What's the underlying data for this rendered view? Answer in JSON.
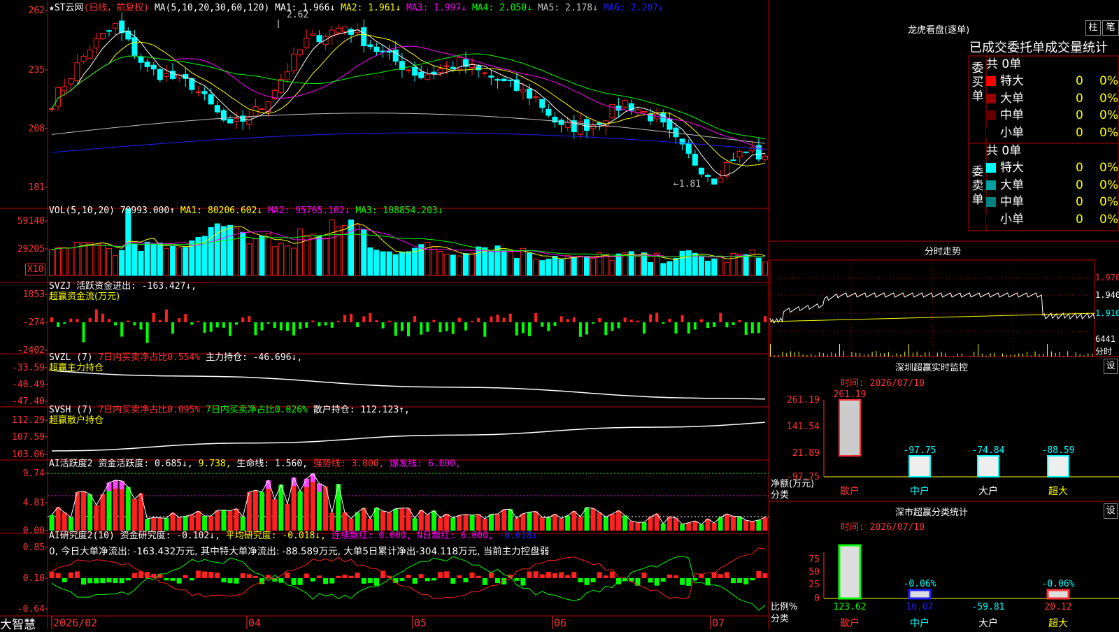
{
  "stock": {
    "name": "★ST云网",
    "period": "(日线，前复权)"
  },
  "main_ma": {
    "prefix": "MA(5,10,20,30,60,120)",
    "items": [
      {
        "text": "MA1: 1.966↓",
        "color": "#ffffff"
      },
      {
        "text": "MA2: 1.961↓",
        "color": "#ffff00"
      },
      {
        "text": "MA3: 1.997↓",
        "color": "#ff00ff"
      },
      {
        "text": "MA4: 2.050↓",
        "color": "#00ff00"
      },
      {
        "text": "MA5: 2.178↓",
        "color": "#c0c0c0"
      },
      {
        "text": "MA6: 2.207↓",
        "color": "#2020ff"
      }
    ],
    "hi_mark": "2.62",
    "lo_mark": "←1.81",
    "y_ticks": [
      "262",
      "235",
      "208",
      "181"
    ]
  },
  "vol": {
    "prefix": "VOL(5,10,20)",
    "value": "79993.000↑",
    "items": [
      {
        "text": "MA1: 80206.602↓",
        "color": "#ffff00"
      },
      {
        "text": "MA2: 95765.102↓",
        "color": "#ff00ff"
      },
      {
        "text": "MA3: 108854.203↓",
        "color": "#00ff00"
      }
    ],
    "y_ticks": [
      "59140",
      "29205"
    ],
    "unit": "X10"
  },
  "svzj": {
    "prefix": "SVZJ",
    "text": "活跃资金进出: -163.427↓,",
    "sub": "超赢资金流(万元)",
    "y_ticks": [
      "1853",
      "-274",
      "-2402"
    ]
  },
  "svzl": {
    "prefix": "SVZL (7)",
    "red_text": "7日内买卖净占比0.554%",
    "text": "主力持仓: -46.696↓,",
    "sub": "超赢主力持仓",
    "y_ticks": [
      "-33.59",
      "-40.49",
      "-47.40"
    ]
  },
  "svsh": {
    "prefix": "SVSH (7)",
    "red_text": "7日内买卖净占比0.095%",
    "green_text": "7日内买卖净占比0.026%",
    "text": "散户持仓: 112.123↑,",
    "sub": "超赢散户持仓",
    "y_ticks": [
      "112.29",
      "107.59",
      "103.06"
    ]
  },
  "ai_active": {
    "prefix": "AI活跃度2",
    "text1": "资金活跃度: 0.685↓,",
    "text2": "9.738,",
    "text3": "生命线: 1.560,",
    "text4": "强势线: 3.000,",
    "text5": "爆发线: 6.000,",
    "y_ticks": [
      "9.74",
      "4.81",
      "0.00"
    ]
  },
  "ai_research": {
    "prefix": "AI研究度2(10)",
    "text1": "资金研究度: -0.102↓,",
    "text2": "平均研究度: -0.018↓,",
    "text3": "连续飘红: 0.000,",
    "text4": "N日飘红: 6.000,",
    "text5": "-0.018↓",
    "summary": "0, 今日大单净流出: -163.432万元, 其中特大单净流出: -88.589万元, 大单5日累计净出-304.118万元, 当前主力控盘弱",
    "y_ticks": [
      "0.85",
      "0.10",
      "-0.64"
    ]
  },
  "x_axis": {
    "brand": "大智慧",
    "labels": [
      "2026/02",
      "04",
      "05",
      "06",
      "07"
    ]
  },
  "lhb": {
    "title": "龙虎看盘(逐单)",
    "btn1": "柱",
    "btn2": "笔",
    "header": "已成交委托单成交量统计",
    "buy_group": "委买单",
    "sell_group": "委卖单",
    "buy_total": "共 0单",
    "sell_total": "共 0单",
    "buy_rows": [
      {
        "label": "特大",
        "v": "0",
        "p": "0%",
        "color": "#ff0000"
      },
      {
        "label": "大单",
        "v": "0",
        "p": "0%",
        "color": "#990000"
      },
      {
        "label": "中单",
        "v": "0",
        "p": "0%",
        "color": "#660000"
      },
      {
        "label": "小单",
        "v": "0",
        "p": "0%",
        "color": "#000000"
      }
    ],
    "sell_rows": [
      {
        "label": "特大",
        "v": "0",
        "p": "0%",
        "color": "#00ffff"
      },
      {
        "label": "大单",
        "v": "0",
        "p": "0%",
        "color": "#00a0a0"
      },
      {
        "label": "中单",
        "v": "0",
        "p": "0%",
        "color": "#008080"
      },
      {
        "label": "小单",
        "v": "0",
        "p": "0%",
        "color": "#000000"
      }
    ]
  },
  "intraday": {
    "title": "分时走势",
    "y_ticks": [
      "1.970",
      "1.940",
      "1.910"
    ],
    "vol_tick": "6441",
    "vol_label": "分时"
  },
  "sz_monitor": {
    "title": "深圳超赢实时监控",
    "btn": "设",
    "date": "时间: 2026/07/10",
    "ylabel": "净额(万元)",
    "xlabel": "分类",
    "y_ticks": [
      "261.19",
      "141.54",
      "21.89",
      "-97.75"
    ],
    "top_label": "261.19"
  },
  "sz_class": {
    "title": "深市超赢分类统计",
    "btn": "设",
    "date": "时间: 2026/07/10",
    "ylabel": "比例%",
    "xlabel": "分类",
    "y_ticks": [
      "75",
      "50",
      "25",
      "0"
    ],
    "bar_labels": [
      "-0.06%",
      "-0.06%"
    ]
  },
  "chart_data": [
    {
      "type": "bar",
      "title": "深圳超赢实时监控",
      "ylabel": "净额(万元)",
      "categories": [
        "散户",
        "中户",
        "大户",
        "超大"
      ],
      "values": [
        261.19,
        -97.75,
        -74.84,
        -88.59
      ],
      "ylim": [
        -97.75,
        261.19
      ]
    },
    {
      "type": "bar",
      "title": "深市超赢分类统计",
      "ylabel": "比例%",
      "categories": [
        "散户",
        "中户",
        "大户",
        "超大"
      ],
      "values": [
        123.62,
        16.07,
        -59.81,
        20.12
      ],
      "ylim": [
        0,
        75
      ]
    }
  ]
}
